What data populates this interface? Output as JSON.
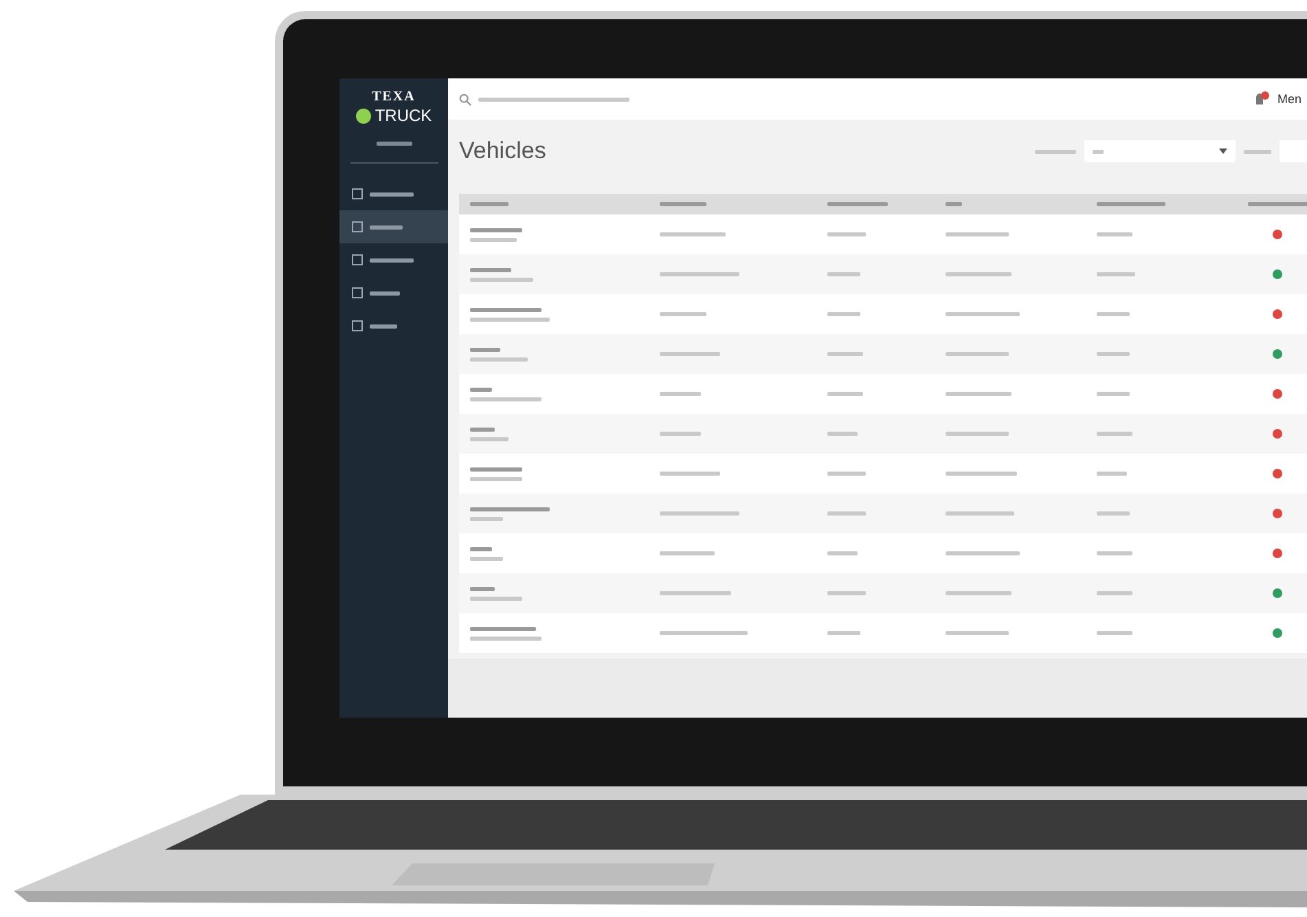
{
  "sidebar": {
    "logo_top": "TEXA",
    "logo_bottom": "TRUCK",
    "items": [
      {
        "selected": false
      },
      {
        "selected": true
      },
      {
        "selected": false
      },
      {
        "selected": false
      },
      {
        "selected": false
      }
    ]
  },
  "topbar": {
    "user": "Men"
  },
  "page": {
    "title": "Vehicles"
  },
  "table": {
    "rows": [
      {
        "color": "#e0453f"
      },
      {
        "color": "#2e9e5e"
      },
      {
        "color": "#e0453f"
      },
      {
        "color": "#2e9e5e"
      },
      {
        "color": "#e0453f"
      },
      {
        "color": "#e0453f"
      },
      {
        "color": "#e0453f"
      },
      {
        "color": "#e0453f"
      },
      {
        "color": "#e0453f"
      },
      {
        "color": "#2e9e5e"
      },
      {
        "color": "#2e9e5e"
      }
    ]
  }
}
